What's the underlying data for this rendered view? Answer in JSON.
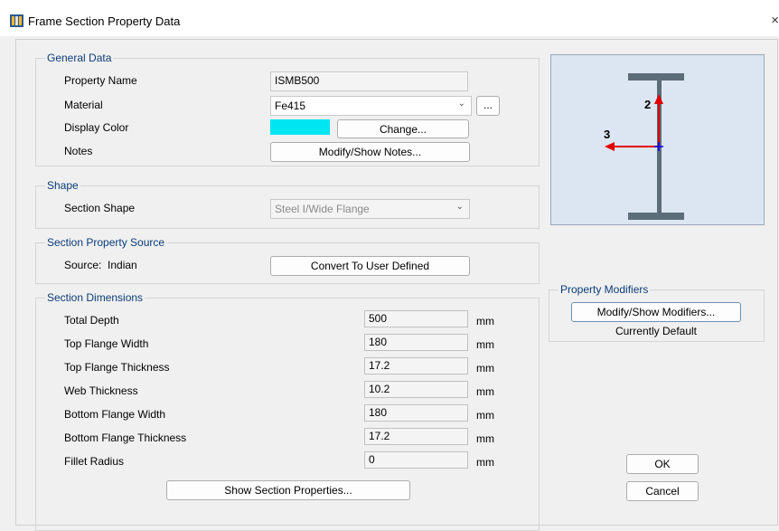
{
  "window": {
    "title": "Frame Section Property Data",
    "close": "×"
  },
  "general": {
    "legend": "General Data",
    "property_name_label": "Property Name",
    "property_name_value": "ISMB500",
    "material_label": "Material",
    "material_value": "Fe415",
    "material_more": "...",
    "display_color_label": "Display Color",
    "display_color": "#00e5f2",
    "change_label": "Change...",
    "notes_label": "Notes",
    "notes_button": "Modify/Show Notes..."
  },
  "shape": {
    "legend": "Shape",
    "section_shape_label": "Section Shape",
    "section_shape_value": "Steel I/Wide Flange"
  },
  "source": {
    "legend": "Section Property Source",
    "source_label": "Source:  Indian",
    "convert_button": "Convert To User Defined"
  },
  "dimensions": {
    "legend": "Section Dimensions",
    "rows": [
      {
        "label": "Total Depth",
        "value": "500",
        "unit": "mm"
      },
      {
        "label": "Top Flange Width",
        "value": "180",
        "unit": "mm"
      },
      {
        "label": "Top Flange Thickness",
        "value": "17.2",
        "unit": "mm"
      },
      {
        "label": "Web Thickness",
        "value": "10.2",
        "unit": "mm"
      },
      {
        "label": "Bottom Flange Width",
        "value": "180",
        "unit": "mm"
      },
      {
        "label": "Bottom Flange Thickness",
        "value": "17.2",
        "unit": "mm"
      },
      {
        "label": "Fillet Radius",
        "value": "0",
        "unit": "mm"
      }
    ],
    "show_props_button": "Show Section Properties..."
  },
  "preview": {
    "axis2_label": "2",
    "axis3_label": "3",
    "axis_color": "#e00000",
    "centroid_color": "#0000ff",
    "section_color": "#5c6c78",
    "bg_color": "#dce6f2"
  },
  "modifiers": {
    "legend": "Property Modifiers",
    "button": "Modify/Show Modifiers...",
    "status": "Currently Default"
  },
  "actions": {
    "ok": "OK",
    "cancel": "Cancel"
  }
}
